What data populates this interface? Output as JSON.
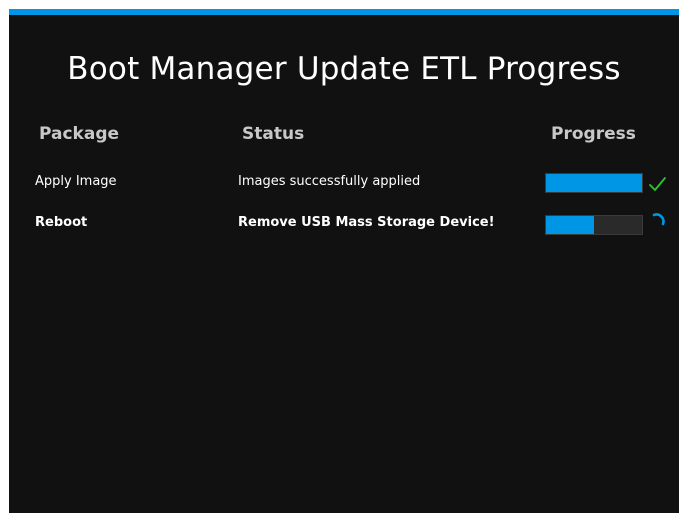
{
  "app": {
    "title": "Boot Manager Update ETL Progress"
  },
  "colors": {
    "accent": "#0096e6",
    "background": "#111111",
    "success": "#2fc52f"
  },
  "table": {
    "headers": {
      "package": "Package",
      "status": "Status",
      "progress": "Progress"
    },
    "rows": [
      {
        "package": "Apply Image",
        "status": "Images successfully applied",
        "progress_fraction": 1.0,
        "state_icon": "checkmark-icon"
      },
      {
        "package": "Reboot",
        "status": "Remove USB Mass Storage Device!",
        "progress_fraction": 0.5,
        "state_icon": "spinner-icon"
      }
    ]
  }
}
